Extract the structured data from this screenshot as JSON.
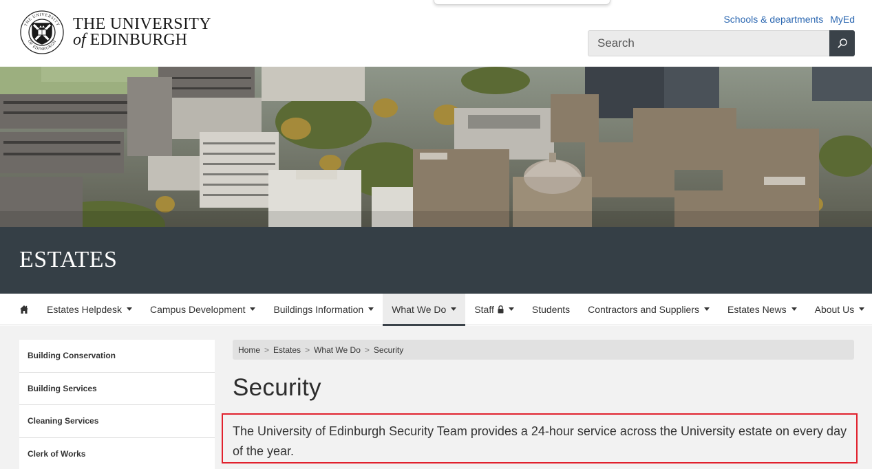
{
  "header": {
    "logo_line1": "THE UNIVERSITY",
    "logo_line2_of": "of",
    "logo_line2_rest": "EDINBURGH",
    "crest_ring_top": "THE UNIVERSITY",
    "crest_ring_bottom": "OF EDINBURGH",
    "links": [
      "Schools & departments",
      "MyEd"
    ],
    "search_placeholder": "Search",
    "search_icon": "magnifier-icon"
  },
  "banner": {
    "title": "ESTATES"
  },
  "nav": {
    "home_icon": "home-icon",
    "items": [
      {
        "label": "Estates Helpdesk",
        "dropdown": true
      },
      {
        "label": "Campus Development",
        "dropdown": true
      },
      {
        "label": "Buildings Information",
        "dropdown": true
      },
      {
        "label": "What We Do",
        "dropdown": true,
        "active": true
      },
      {
        "label": "Staff",
        "dropdown": true,
        "locked": true
      },
      {
        "label": "Students",
        "dropdown": false
      },
      {
        "label": "Contractors and Suppliers",
        "dropdown": true
      },
      {
        "label": "Estates News",
        "dropdown": true
      },
      {
        "label": "About Us",
        "dropdown": true
      }
    ]
  },
  "sidebar": {
    "items": [
      {
        "label": "Building Conservation"
      },
      {
        "label": "Building Services"
      },
      {
        "label": "Cleaning Services"
      },
      {
        "label": "Clerk of Works"
      }
    ]
  },
  "breadcrumb": {
    "items": [
      "Home",
      "Estates",
      "What We Do",
      "Security"
    ],
    "separator": ">"
  },
  "main": {
    "title": "Security",
    "intro": "The University of Edinburgh Security Team provides a 24-hour service across the University estate on every day of the year."
  },
  "colors": {
    "banner_bg": "#353f46",
    "link": "#2b67b1",
    "highlight": "#e1212d",
    "content_bg": "#f2f2f2"
  }
}
